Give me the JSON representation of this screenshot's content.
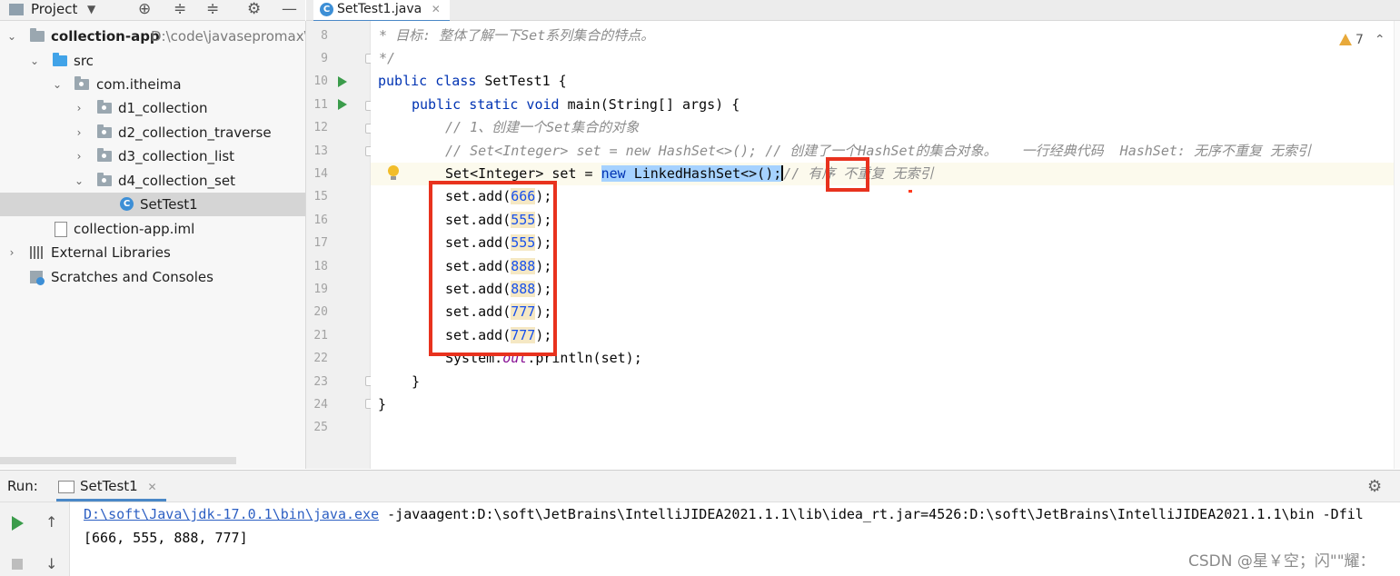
{
  "project_panel": {
    "title": "Project",
    "tree": [
      {
        "name": "collection-app",
        "path": "D:\\code\\javasepromax\\c",
        "type": "module"
      },
      {
        "name": "src",
        "type": "source-folder"
      },
      {
        "name": "com.itheima",
        "type": "package"
      },
      {
        "name": "d1_collection",
        "type": "package"
      },
      {
        "name": "d2_collection_traverse",
        "type": "package"
      },
      {
        "name": "d3_collection_list",
        "type": "package"
      },
      {
        "name": "d4_collection_set",
        "type": "package"
      },
      {
        "name": "SetTest1",
        "type": "class",
        "selected": true
      },
      {
        "name": "collection-app.iml",
        "type": "file"
      },
      {
        "name": "External Libraries",
        "type": "libraries"
      },
      {
        "name": "Scratches and Consoles",
        "type": "scratches"
      }
    ]
  },
  "editor": {
    "tab_label": "SetTest1.java",
    "tab_icon": "class-c-icon",
    "inspection_warnings": "7",
    "lines": [
      {
        "n": "8"
      },
      {
        "n": "9"
      },
      {
        "n": "10"
      },
      {
        "n": "11"
      },
      {
        "n": "12"
      },
      {
        "n": "13"
      },
      {
        "n": "14"
      },
      {
        "n": "15"
      },
      {
        "n": "16"
      },
      {
        "n": "17"
      },
      {
        "n": "18"
      },
      {
        "n": "19"
      },
      {
        "n": "20"
      },
      {
        "n": "21"
      },
      {
        "n": "22"
      },
      {
        "n": "23"
      },
      {
        "n": "24"
      },
      {
        "n": "25"
      }
    ],
    "code": {
      "l8_comment": " * 目标: 整体了解一下Set系列集合的特点。",
      "l9_comment": " */",
      "l10_kw": "public class",
      "l10_rest": " SetTest1 {",
      "l11_kw1": "public static void",
      "l11_rest": " main(String[] args) {",
      "l12_comment": "// 1、创建一个Set集合的对象",
      "l13_comment": "// Set<Integer> set = new HashSet<>(); // 创建了一个HashSet的集合对象。   一行经典代码  HashSet: 无序不重复 无索引",
      "l14_a": "Set<Integer> set = ",
      "l14_new": "new",
      "l14_sel_rest": " LinkedHashSet<>();",
      "l14_comment_a": "// ",
      "l14_comment_b": "有序",
      "l14_comment_c": " 不重复 无索引",
      "add_prefix": "set.add(",
      "add_suffix": ");",
      "add_values": [
        "666",
        "555",
        "555",
        "888",
        "888",
        "777",
        "777"
      ],
      "l22_a": "System.",
      "l22_out": "out",
      "l22_b": ".println(set);",
      "close_inner": "}",
      "close_outer": "}"
    }
  },
  "run_panel": {
    "label": "Run:",
    "tab_label": "SetTest1",
    "command_link": "D:\\soft\\Java\\jdk-17.0.1\\bin\\java.exe",
    "command_rest": " -javaagent:D:\\soft\\JetBrains\\IntelliJIDEA2021.1.1\\lib\\idea_rt.jar=4526:D:\\soft\\JetBrains\\IntelliJIDEA2021.1.1\\bin -Dfil",
    "output": "[666, 555, 888, 777]"
  },
  "watermark": "CSDN @星￥空；闪\"\"耀：",
  "colors": {
    "annotation_red": "#e8321e",
    "keyword": "#0033b3",
    "number": "#1750eb",
    "comment": "#8c8c8c",
    "run_green": "#3b9c4b"
  }
}
